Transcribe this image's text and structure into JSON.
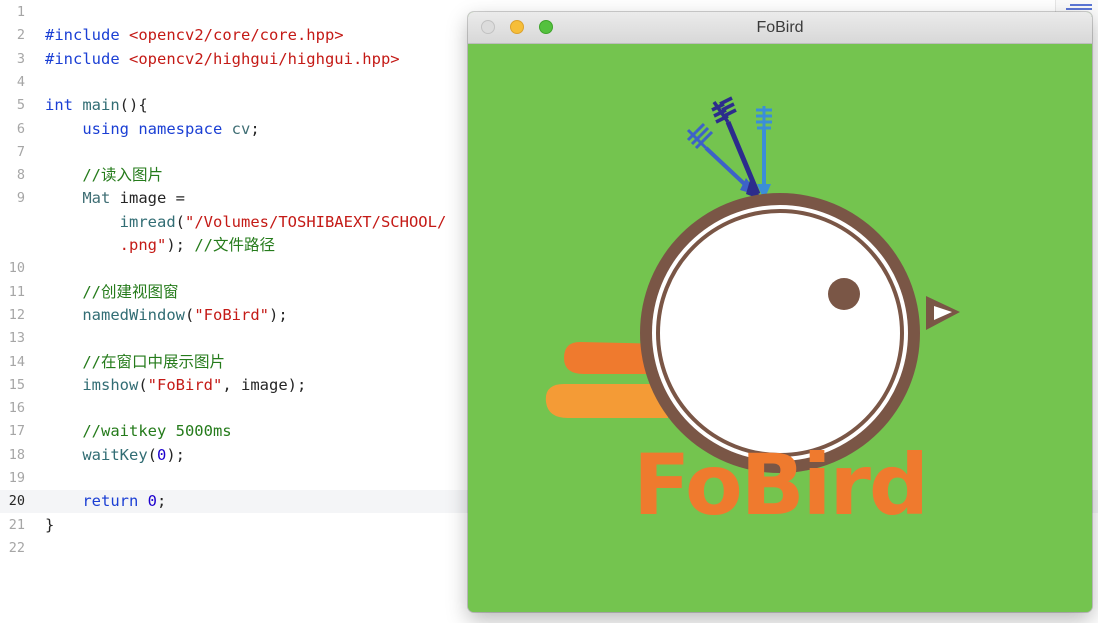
{
  "editor": {
    "current_line": 20,
    "lines": [
      {
        "n": "1",
        "tokens": []
      },
      {
        "n": "2",
        "tokens": [
          {
            "t": "#include ",
            "c": "kw"
          },
          {
            "t": "<opencv2/core/core.hpp>",
            "c": "inc"
          }
        ]
      },
      {
        "n": "3",
        "tokens": [
          {
            "t": "#include ",
            "c": "kw"
          },
          {
            "t": "<opencv2/highgui/highgui.hpp>",
            "c": "inc"
          }
        ]
      },
      {
        "n": "4",
        "tokens": []
      },
      {
        "n": "5",
        "tokens": [
          {
            "t": "int ",
            "c": "kw"
          },
          {
            "t": "main",
            "c": "fn"
          },
          {
            "t": "(){",
            "c": "pl"
          }
        ]
      },
      {
        "n": "6",
        "tokens": [
          {
            "t": "    using namespace ",
            "c": "kw"
          },
          {
            "t": "cv",
            "c": "typ"
          },
          {
            "t": ";",
            "c": "pl"
          }
        ]
      },
      {
        "n": "7",
        "tokens": []
      },
      {
        "n": "8",
        "tokens": [
          {
            "t": "    //读入图片",
            "c": "cmt"
          }
        ]
      },
      {
        "n": "9",
        "tokens": [
          {
            "t": "    ",
            "c": "pl"
          },
          {
            "t": "Mat",
            "c": "typ"
          },
          {
            "t": " image =",
            "c": "pl"
          }
        ]
      },
      {
        "n": "",
        "tokens": [
          {
            "t": "        ",
            "c": "pl"
          },
          {
            "t": "imread",
            "c": "fn"
          },
          {
            "t": "(",
            "c": "pl"
          },
          {
            "t": "\"/Volumes/TOSHIBAEXT/SCHOOL/",
            "c": "str"
          }
        ]
      },
      {
        "n": "",
        "tokens": [
          {
            "t": "        ",
            "c": "pl"
          },
          {
            "t": ".png\"",
            "c": "str"
          },
          {
            "t": "); ",
            "c": "pl"
          },
          {
            "t": "//文件路径",
            "c": "cmt"
          }
        ]
      },
      {
        "n": "10",
        "tokens": []
      },
      {
        "n": "11",
        "tokens": [
          {
            "t": "    //创建视图窗",
            "c": "cmt"
          }
        ]
      },
      {
        "n": "12",
        "tokens": [
          {
            "t": "    ",
            "c": "pl"
          },
          {
            "t": "namedWindow",
            "c": "fn"
          },
          {
            "t": "(",
            "c": "pl"
          },
          {
            "t": "\"FoBird\"",
            "c": "str"
          },
          {
            "t": ");",
            "c": "pl"
          }
        ]
      },
      {
        "n": "13",
        "tokens": []
      },
      {
        "n": "14",
        "tokens": [
          {
            "t": "    //在窗口中展示图片",
            "c": "cmt"
          }
        ]
      },
      {
        "n": "15",
        "tokens": [
          {
            "t": "    ",
            "c": "pl"
          },
          {
            "t": "imshow",
            "c": "fn"
          },
          {
            "t": "(",
            "c": "pl"
          },
          {
            "t": "\"FoBird\"",
            "c": "str"
          },
          {
            "t": ", image);",
            "c": "pl"
          }
        ]
      },
      {
        "n": "16",
        "tokens": []
      },
      {
        "n": "17",
        "tokens": [
          {
            "t": "    //waitkey 5000ms",
            "c": "cmt"
          }
        ]
      },
      {
        "n": "18",
        "tokens": [
          {
            "t": "    ",
            "c": "pl"
          },
          {
            "t": "waitKey",
            "c": "fn"
          },
          {
            "t": "(",
            "c": "pl"
          },
          {
            "t": "0",
            "c": "num"
          },
          {
            "t": ");",
            "c": "pl"
          }
        ]
      },
      {
        "n": "19",
        "tokens": []
      },
      {
        "n": "20",
        "tokens": [
          {
            "t": "    return ",
            "c": "kw"
          },
          {
            "t": "0",
            "c": "num"
          },
          {
            "t": ";",
            "c": "pl"
          }
        ]
      },
      {
        "n": "21",
        "tokens": [
          {
            "t": "}",
            "c": "pl"
          }
        ]
      },
      {
        "n": "22",
        "tokens": []
      }
    ]
  },
  "window": {
    "title": "FoBird",
    "image": {
      "logo_text": "FoBird",
      "colors": {
        "background": "#74c44f",
        "ring": "#7a5646",
        "face": "#ffffff",
        "eye": "#7a5646",
        "text": "#ef7a2e",
        "wing_top": "#ef7a2e",
        "wing_bottom": "#f49b36",
        "arrow_dark": "#2c2c8c",
        "arrow_mid": "#3d62c8",
        "arrow_light": "#3b8ed8"
      }
    }
  }
}
